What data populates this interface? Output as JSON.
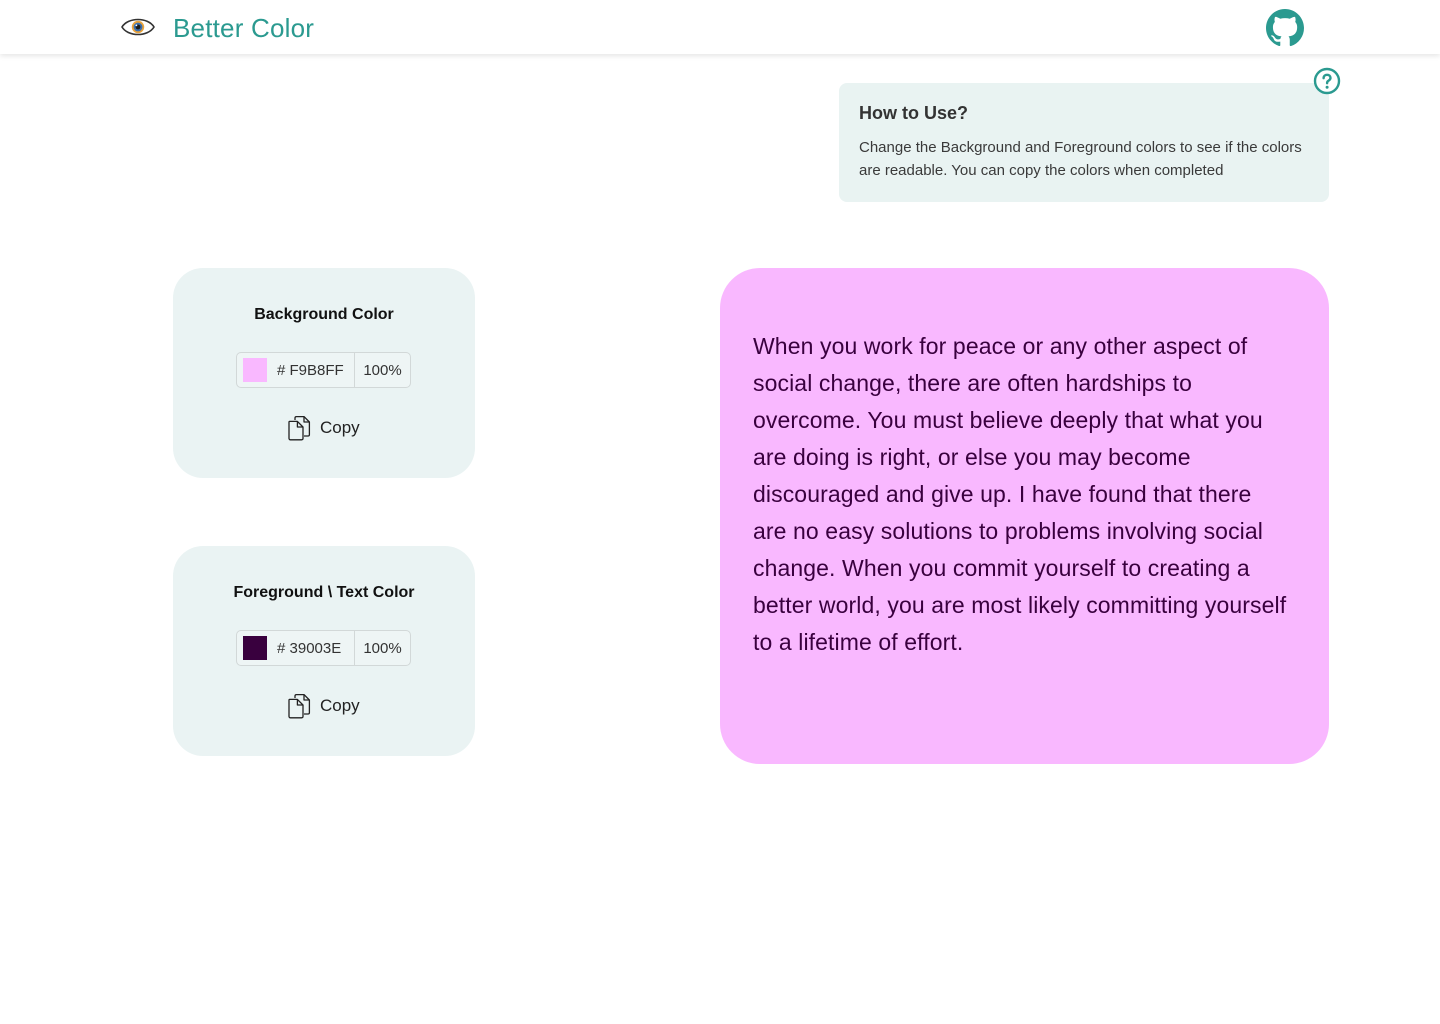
{
  "header": {
    "logo_icon": "eye-icon",
    "title": "Better Color",
    "github_icon": "github-icon",
    "brand_color": "#2b9a90"
  },
  "help": {
    "icon": "question-circle-icon",
    "title": "How to Use?",
    "text": "Change the Background and Foreground colors to see if the colors are readable. You can copy the colors when completed"
  },
  "background": {
    "title": "Background Color",
    "color": "#F9B8FF",
    "hex_prefix": "#",
    "hex_value": "F9B8FF",
    "hex_display": "# F9B8FF",
    "alpha": "100%",
    "copy_label": "Copy",
    "copy_icon": "copy-icon"
  },
  "foreground": {
    "title": "Foreground \\ Text Color",
    "color": "#39003E",
    "hex_prefix": "#",
    "hex_value": "39003E",
    "hex_display": "# 39003E",
    "alpha": "100%",
    "copy_label": "Copy",
    "copy_icon": "copy-icon"
  },
  "preview": {
    "text": "When you work for peace or any other aspect of social change, there are often hardships to overcome. You must believe deeply that what you are doing is right, or else you may become discouraged and give up. I have found that there are no easy solutions to problems involving social change. When you commit yourself to creating a better world, you are most likely committing yourself to a lifetime of effort."
  }
}
